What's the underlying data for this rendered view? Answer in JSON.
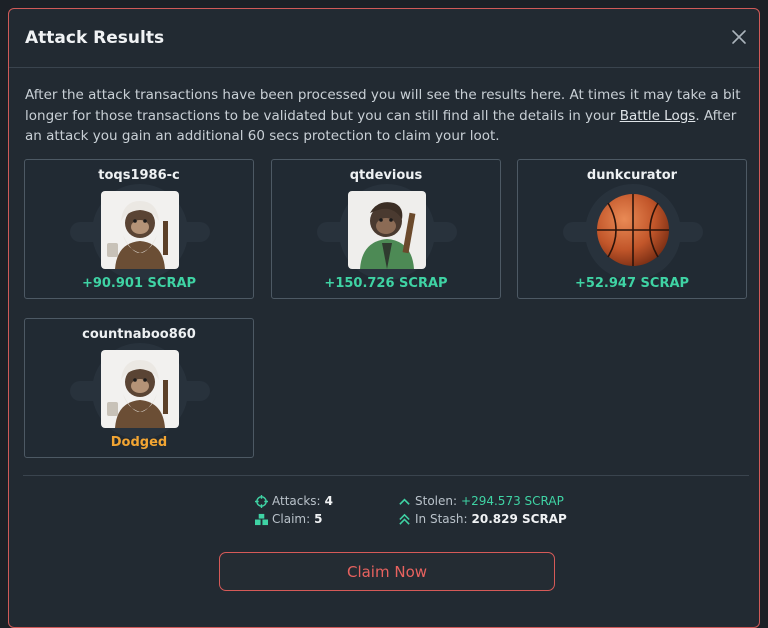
{
  "modal": {
    "title": "Attack Results",
    "close_icon": "close-icon",
    "description_before": "After the attack transactions have been processed you will see the results here. At times it may take a bit longer for those transactions to be validated but you can still find all the details in your ",
    "description_link": "Battle Logs",
    "description_after": ". After an attack you gain an additional 60 secs protection to claim your loot."
  },
  "results": [
    {
      "name": "toqs1986-c",
      "avatar": "ape-wizard-avatar",
      "result": "+90.901 SCRAP",
      "status": "gain"
    },
    {
      "name": "qtdevious",
      "avatar": "ape-green-jacket-avatar",
      "result": "+150.726 SCRAP",
      "status": "gain"
    },
    {
      "name": "dunkcurator",
      "avatar": "basketball-avatar",
      "result": "+52.947 SCRAP",
      "status": "gain"
    },
    {
      "name": "countnaboo860",
      "avatar": "ape-wizard-avatar",
      "result": "Dodged",
      "status": "dodged"
    }
  ],
  "stats": {
    "attacks_label": "Attacks:",
    "attacks_value": "4",
    "claim_label": "Claim:",
    "claim_value": "5",
    "stolen_label": "Stolen:",
    "stolen_value": "+294.573 SCRAP",
    "stash_label": "In Stash:",
    "stash_value": "20.829 SCRAP"
  },
  "claim_button": "Claim Now",
  "colors": {
    "accent": "#d65a58",
    "gain": "#3fd3a4",
    "dodged": "#f2a533",
    "stat_icon": "#3fd3a4"
  }
}
